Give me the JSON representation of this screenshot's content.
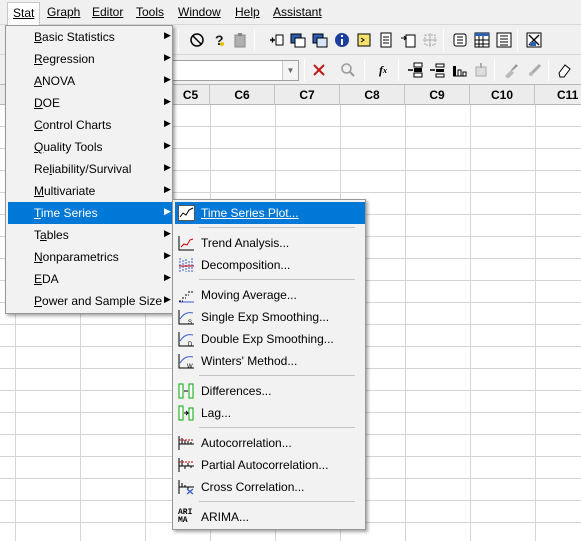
{
  "menubar": {
    "items": [
      "Stat",
      "Graph",
      "Editor",
      "Tools",
      "Window",
      "Help",
      "Assistant"
    ]
  },
  "worksheet": {
    "columns": [
      "C5",
      "C6",
      "C7",
      "C8",
      "C9",
      "C10",
      "C11"
    ]
  },
  "stat_menu": {
    "items": [
      {
        "label": "Basic Statistics",
        "key": "B",
        "rest": "asic Statistics"
      },
      {
        "label": "Regression",
        "key": "R",
        "rest": "egression"
      },
      {
        "label": "ANOVA",
        "key": "A",
        "rest": "NOVA"
      },
      {
        "label": "DOE",
        "key": "D",
        "rest": "OE"
      },
      {
        "label": "Control Charts",
        "key": "C",
        "rest": "ontrol Charts"
      },
      {
        "label": "Quality Tools",
        "key": "Q",
        "rest": "uality Tools"
      },
      {
        "label": "Reliability/Survival",
        "pre": "Re",
        "key": "l",
        "rest": "iability/Survival"
      },
      {
        "label": "Multivariate",
        "key": "M",
        "rest": "ultivariate"
      },
      {
        "label": "Time Series",
        "key": "T",
        "rest": "ime Series"
      },
      {
        "label": "Tables",
        "pre": "T",
        "key": "a",
        "rest": "bles"
      },
      {
        "label": "Nonparametrics",
        "key": "N",
        "rest": "onparametrics"
      },
      {
        "label": "EDA",
        "key": "E",
        "rest": "DA"
      },
      {
        "label": "Power and Sample Size",
        "key": "P",
        "rest": "ower and Sample Size"
      }
    ]
  },
  "time_series_menu": {
    "items": [
      {
        "label": "Time Series Plot...",
        "icon": "time-series-plot-icon"
      },
      {
        "label": "Trend Analysis...",
        "icon": "trend-analysis-icon"
      },
      {
        "label": "Decomposition...",
        "icon": "decomposition-icon"
      },
      {
        "label": "Moving Average...",
        "icon": "moving-average-icon"
      },
      {
        "label": "Single Exp Smoothing...",
        "icon": "single-exp-smoothing-icon"
      },
      {
        "label": "Double Exp Smoothing...",
        "icon": "double-exp-smoothing-icon"
      },
      {
        "label": "Winters' Method...",
        "icon": "winters-method-icon"
      },
      {
        "label": "Differences...",
        "icon": "differences-icon"
      },
      {
        "label": "Lag...",
        "icon": "lag-icon"
      },
      {
        "label": "Autocorrelation...",
        "icon": "autocorrelation-icon"
      },
      {
        "label": "Partial Autocorrelation...",
        "icon": "partial-autocorrelation-icon"
      },
      {
        "label": "Cross Correlation...",
        "icon": "cross-correlation-icon"
      },
      {
        "label": "ARIMA...",
        "icon": "arima-icon"
      }
    ]
  },
  "toolbar": {
    "fx_label": "f",
    "fx_sub": "x",
    "arima_icon_text": [
      "ARI",
      "MA"
    ]
  },
  "colors": {
    "highlight": "#0078d7",
    "menu_bg": "#f2f2f2"
  }
}
